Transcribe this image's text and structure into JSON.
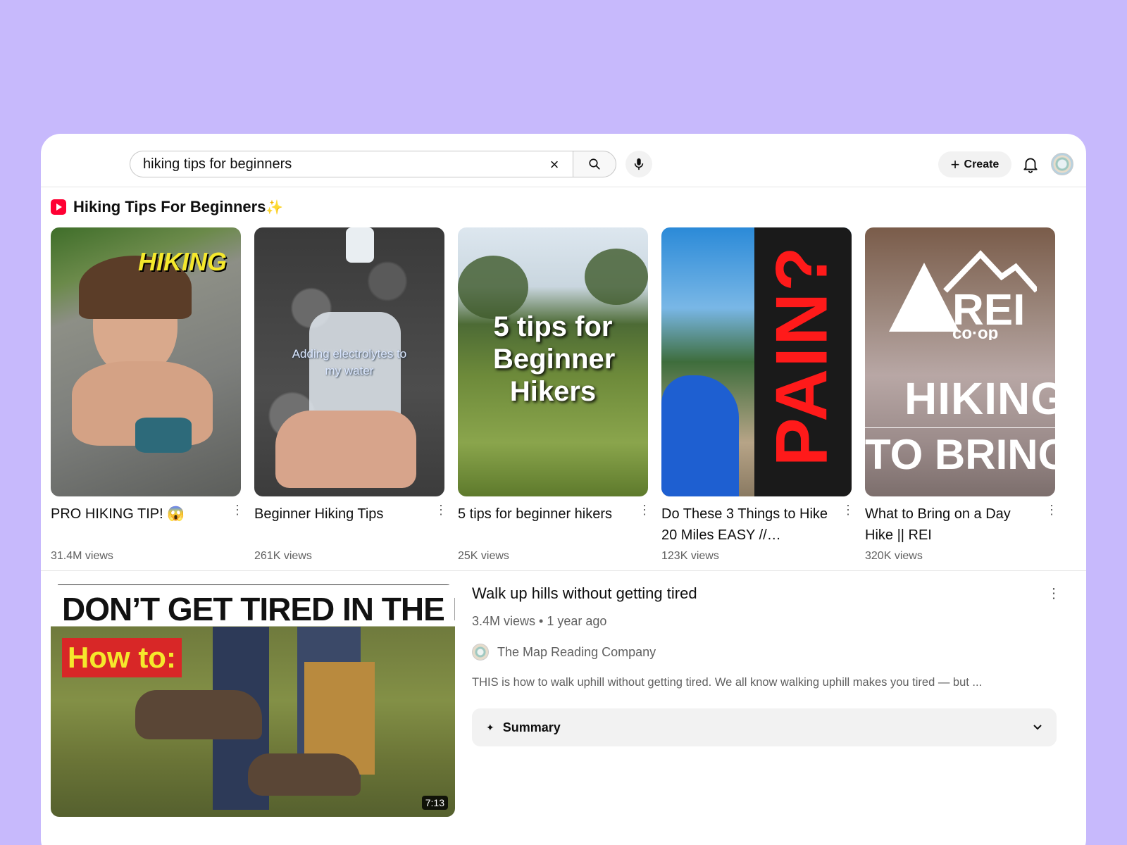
{
  "search": {
    "value": "hiking tips for beginners",
    "clear_icon": "×"
  },
  "header": {
    "create_label": "Create"
  },
  "shelf": {
    "title": "Hiking Tips For Beginners",
    "sparkle": "✨",
    "videos": [
      {
        "title": "PRO HIKING TIP! 😱",
        "views": "31.4M views",
        "thumb_text": "HIKING"
      },
      {
        "title": "Beginner Hiking Tips",
        "views": "261K views",
        "thumb_text": "Adding electrolytes to my water"
      },
      {
        "title": "5 tips for beginner hikers",
        "views": "25K views",
        "thumb_text": "5 tips for Beginner Hikers"
      },
      {
        "title": "Do These 3 Things to Hike 20 Miles EASY //…",
        "views": "123K views",
        "thumb_text": "PAIN?"
      },
      {
        "title": "What to Bring on a Day Hike || REI",
        "views": "320K views",
        "thumb_text": "HIKING",
        "thumb_text2": "TO BRING ON",
        "logo_text": "REI",
        "logo_sub": "co·op"
      }
    ]
  },
  "featured": {
    "title": "Walk up hills without getting tired",
    "meta": "3.4M views • 1 year ago",
    "channel": "The Map Reading Company",
    "description": "THIS is how to walk uphill without getting tired. We all know walking uphill makes you tired — but ...",
    "duration": "7:13",
    "thumb_headline": "DON’T GET TIRED IN THE HILLS",
    "thumb_tag": "How to:",
    "summary_label": "Summary"
  }
}
